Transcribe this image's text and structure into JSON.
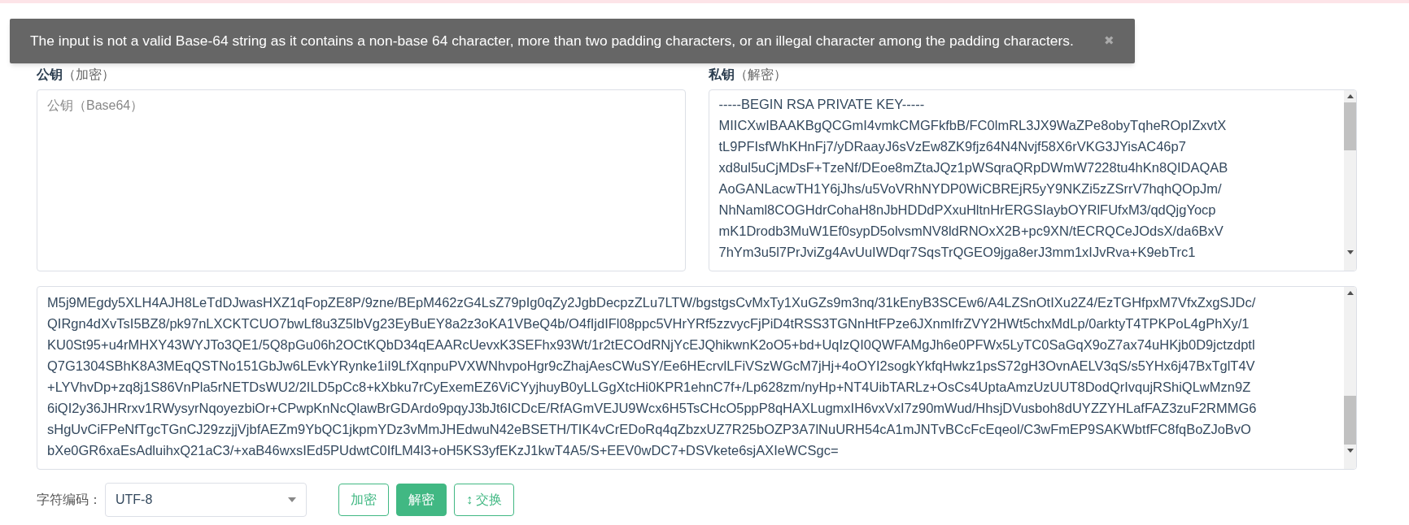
{
  "toast": {
    "message": "The input is not a valid Base-64 string as it contains a non-base 64 character, more than two padding characters, or an illegal character among the padding characters.",
    "close": "✖"
  },
  "public_key": {
    "title": "公钥",
    "hint": "（加密）",
    "placeholder": "公钥（Base64）"
  },
  "private_key": {
    "title": "私钥",
    "hint": "（解密）",
    "lines": [
      "-----BEGIN RSA PRIVATE KEY-----",
      "MIICXwIBAAKBgQCGmI4vmkCMGFkfbB/FC0lmRL3JX9WaZPe8obyTqheROpIZxvtX",
      "tL9PFIsfWhKHnFj7/yDRaayJ6sVzEw8ZK9fjz64N4Nvjf58X6rVKG3JYisAC46p7",
      "xd8ul5uCjMDsF+TzeNf/DEoe8mZtaJQz1pWSqraQRpDWmW7228tu4hKn8QIDAQAB",
      "AoGANLacwTH1Y6jJhs/u5VoVRhNYDP0WiCBREjR5yY9NKZi5zZSrrV7hqhQOpJm/",
      "NhNaml8COGHdrCohaH8nJbHDDdPXxuHltnHrERGSIaybOYRlFUfxM3/qdQjgYocp",
      "mK1Drodb3MuW1Ef0sypD5olvsmNV8ldRNOxX2B+pc9XN/tECRQCeJOdsX/da6BxV",
      "7hYm3u5l7PrJviZg4AvUuIWDqr7SqsTrQGEO9jga8erJ3mm1xIJvRva+K9ebTrc1"
    ]
  },
  "output": {
    "lines": [
      "M5j9MEgdy5XLH4AJH8LeTdDJwasHXZ1qFopZE8P/9zne/BEpM462zG4LsZ79pIg0qZy2JgbDecpzZLu7LTW/bgstgsCvMxTy1XuGZs9m3nq/31kEnyB3SCEw6/A4LZSnOtIXu2Z4/EzTGHfpxM7VfxZxgSJDc/",
      "QIRgn4dXvTsI5BZ8/pk97nLXCKTCUO7bwLf8u3Z5lbVg23EyBuEY8a2z3oKA1VBeQ4b/O4fIjdIFl08ppc5VHrYRf5zzvycFjPiD4tRSS3TGNnHtFPze6JXnmIfrZVY2HWt5chxMdLp/0arktyT4TPKPoL4gPhXy/1",
      "KU0St95+u4rMHXY43WYJTo3QE1/5Q8pGu06h2OCtKQbD34qEAARcUevxK3SEFhx93Wt/1r2tECOdRNjYcEJQhikwnK2oO5+bd+UqIzQI0QWFAMgJh6e0PFWx5LyTC0SaGqX9oZ7ax74uHKjb0D9jctzdptl",
      "Q7G1304SBhK8A3MEqQSTNo151GbJw6LEvkYRynke1iI9LfXqnpuPVXWNhvpoHgr9cZhajAesCWuSY/Ee6HEcrvlLFiVSzWGcM7jHj+4oOYI2sogkYkfqHwkz1psS72gH3OvnAELV3qS/s5YHx6j47BxTglT4V",
      "+LYVhvDp+zq8j1S86VnPla5rNETDsWU2/2ILD5pCc8+kXbku7rCyExemEZ6ViCYyjhuyB0yLLGgXtcHi0KPR1ehnC7f+/Lp628zm/nyHp+NT4UibTARLz+OsCs4UptaAmzUzUUT8DodQrIvqujRShiQLwMzn9Z",
      "6iQI2y36JHRrxv1RWysyrNqoyezbiOr+CPwpKnNcQlawBrGDArdo9pqyJ3bJt6ICDcE/RfAGmVEJU9Wcx6H5TsCHcO5ppP8qHAXLugmxIH6vxVxI7z90mWud/HhsjDVusboh8dUYZZYHLafFAZ3zuF2RMMG6",
      "sHgUvCiFPeNfTgcTGnCJ29zzjjVjbfAEZm9YbQC1jkpmYDz3vMmJHEdwuN42eBSETH/TIK4vCrEDoRq4qZbzxUZ7R25bOZP3A7lNuURH54cA1mJNTvBCcFcEqeol/C3wFmEP9SAKWbtfFC8fqBoZJoBvO",
      "bXe0GR6xaEsAdluihxQ21aC3/+xaB46wxsIEd5PUdwtC0IfLM4l3+oH5KS3yfEKzJ1kwT4A5/S+EEV0wDC7+DSVkete6sjAXIeWCSgc="
    ]
  },
  "encoding": {
    "label": "字符编码：",
    "value": "UTF-8"
  },
  "buttons": [
    {
      "label": "加密",
      "selected": false
    },
    {
      "label": "解密",
      "selected": true
    },
    {
      "label": "交换",
      "icon": "↕",
      "selected": false
    }
  ]
}
